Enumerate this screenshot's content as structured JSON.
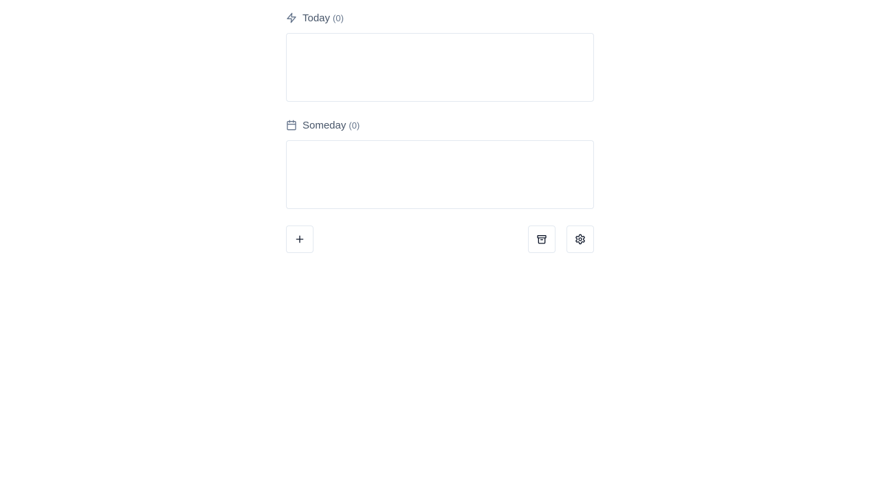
{
  "sections": [
    {
      "title": "Today",
      "count": "(0)",
      "icon": "lightning-bolt-icon"
    },
    {
      "title": "Someday",
      "count": "(0)",
      "icon": "calendar-icon"
    }
  ],
  "toolbar": {
    "add_icon": "plus-icon",
    "archive_icon": "archive-icon",
    "settings_icon": "gear-icon"
  },
  "colors": {
    "text": "#475569",
    "border": "#e2e8f0",
    "icon": "#0f172a"
  }
}
